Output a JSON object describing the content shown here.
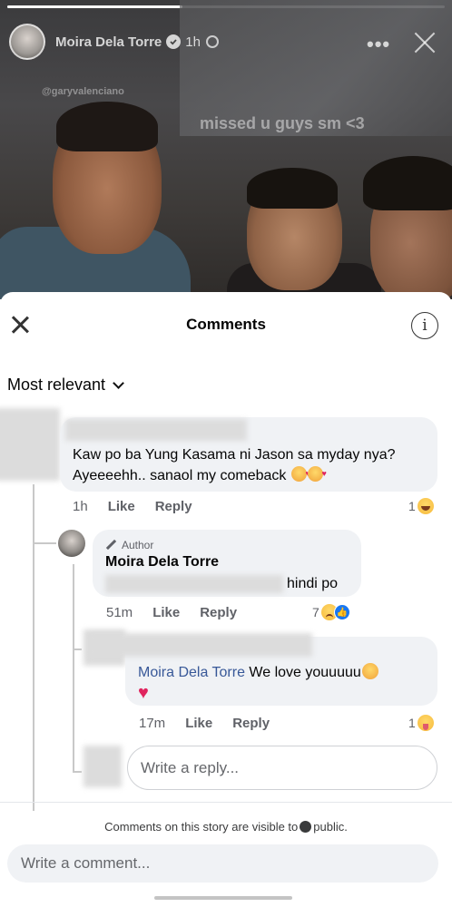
{
  "story": {
    "author": "Moira Dela Torre",
    "time": "1h",
    "tag": "@garyvalenciano",
    "caption": "missed u guys sm <3",
    "more_label": "•••"
  },
  "sheet": {
    "title": "Comments",
    "info_glyph": "i",
    "sort_label": "Most relevant"
  },
  "comments": [
    {
      "text_line1": "Kaw po ba Yung Kasama ni Jason sa myday nya?",
      "text_line2": "Ayeeeehh.. sanaol my comeback",
      "time": "1h",
      "like_label": "Like",
      "reply_label": "Reply",
      "reaction_count": "1"
    },
    {
      "author_badge": "Author",
      "author": "Moira Dela Torre",
      "text": "hindi po",
      "time": "51m",
      "like_label": "Like",
      "reply_label": "Reply",
      "reaction_count": "7"
    },
    {
      "mention": "Moira Dela Torre",
      "text": "We love youuuuu",
      "time": "17m",
      "like_label": "Like",
      "reply_label": "Reply",
      "reaction_count": "1"
    }
  ],
  "reply_input": {
    "placeholder": "Write a reply..."
  },
  "footer": {
    "visibility_prefix": "Comments on this story are visible to",
    "visibility_suffix": "public.",
    "comment_placeholder": "Write a comment..."
  }
}
